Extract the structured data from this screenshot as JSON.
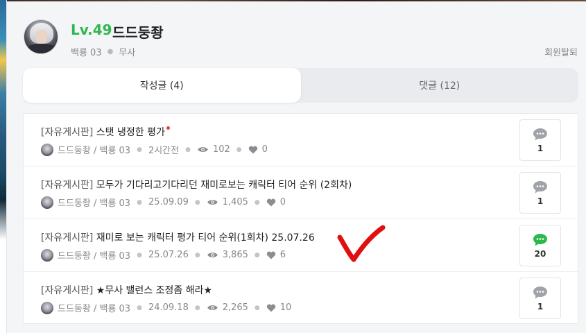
{
  "profile": {
    "level": "Lv.49",
    "nickname": "드드둥좡",
    "server": "백룡 03",
    "job": "무사",
    "withdraw_label": "회원탈퇴"
  },
  "tabs": [
    {
      "label": "작성글 (4)",
      "active": true
    },
    {
      "label": "댓글 (12)",
      "active": false
    }
  ],
  "posts": [
    {
      "board": "[자유게시판]",
      "title": "스탯 냉정한 평가",
      "is_new": true,
      "author": "드드둥좡 / 백룡 03",
      "date": "2시간전",
      "views": "102",
      "likes": "0",
      "comments": "1",
      "comment_color": "#a0a4aa"
    },
    {
      "board": "[자유게시판]",
      "title": "모두가 기다리고기다리던 재미로보는 캐릭터 티어 순위 (2회차)",
      "is_new": false,
      "author": "드드둥좡 / 백룡 03",
      "date": "25.09.09",
      "views": "1,405",
      "likes": "0",
      "comments": "1",
      "comment_color": "#a0a4aa"
    },
    {
      "board": "[자유게시판]",
      "title": "재미로 보는 캐릭터 평가 티어 순위(1회차) 25.07.26",
      "is_new": false,
      "author": "드드둥좡 / 백룡 03",
      "date": "25.07.26",
      "views": "3,865",
      "likes": "6",
      "comments": "20",
      "comment_color": "#2db84f"
    },
    {
      "board": "[자유게시판]",
      "title": "★무사 밸런스 조정좀 해라★",
      "is_new": false,
      "author": "드드둥좡 / 백룡 03",
      "date": "24.09.18",
      "views": "2,265",
      "likes": "10",
      "comments": "1",
      "comment_color": "#a0a4aa"
    }
  ],
  "icons": {
    "avatar": "avatar",
    "views": "eye-icon",
    "likes": "heart-icon",
    "comments": "speech-bubble-icon",
    "annotation": "red-checkmark"
  },
  "colors": {
    "level": "#2db84f",
    "new_dot": "#ee3b3b",
    "checkmark": "#e01010"
  }
}
